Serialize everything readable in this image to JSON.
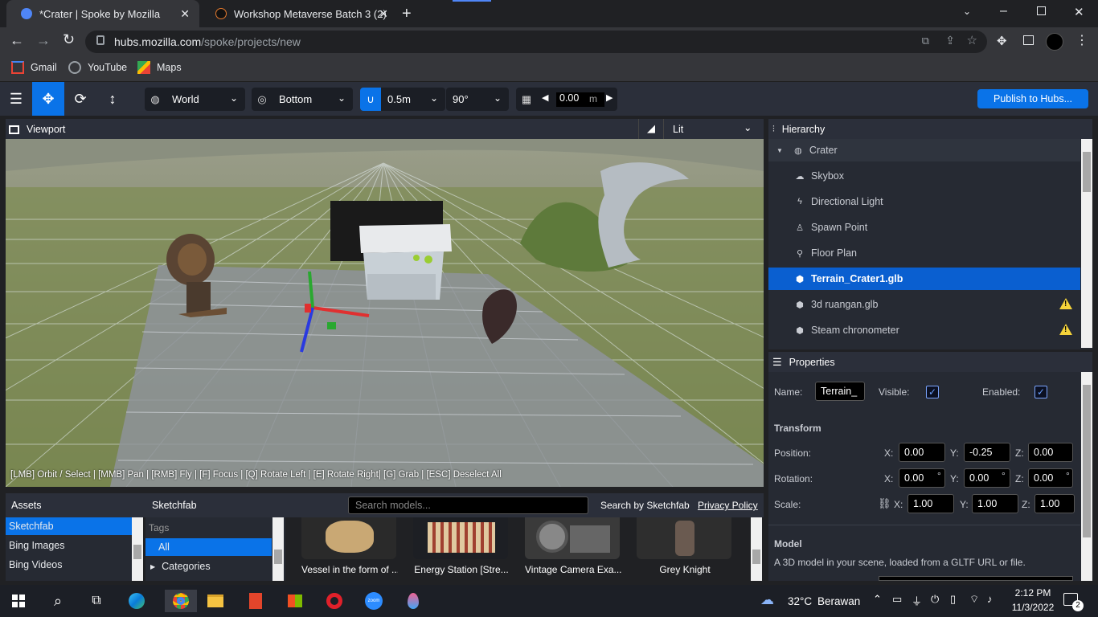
{
  "browser": {
    "tabs": [
      {
        "title": "*Crater | Spoke by Mozilla",
        "active": true
      },
      {
        "title": "Workshop Metaverse Batch 3 (2)",
        "active": false
      }
    ],
    "url_host": "hubs.mozilla.com",
    "url_path": "/spoke/projects/new",
    "bookmarks": [
      "Gmail",
      "YouTube",
      "Maps"
    ]
  },
  "toolbar": {
    "transform_space": "World",
    "pivot": "Bottom",
    "snap_translation": "0.5m",
    "snap_rotation": "90°",
    "grid_height": "0.00",
    "grid_unit": "m",
    "publish_label": "Publish to Hubs..."
  },
  "viewport": {
    "title": "Viewport",
    "render_mode": "Lit",
    "hint": "[LMB] Orbit / Select | [MMB] Pan | [RMB] Fly | [F] Focus | [Q] Rotate Left | [E] Rotate Right| [G] Grab | [ESC] Deselect All"
  },
  "hierarchy": {
    "title": "Hierarchy",
    "items": [
      {
        "label": "Crater",
        "icon": "globe-icon",
        "warning": false
      },
      {
        "label": "Skybox",
        "icon": "cloud-icon",
        "warning": false
      },
      {
        "label": "Directional Light",
        "icon": "bolt-icon",
        "warning": false
      },
      {
        "label": "Spawn Point",
        "icon": "person-icon",
        "warning": false
      },
      {
        "label": "Floor Plan",
        "icon": "walk-icon",
        "warning": false
      },
      {
        "label": "Terrain_Crater1.glb",
        "icon": "cube-icon",
        "warning": false,
        "selected": true
      },
      {
        "label": "3d ruangan.glb",
        "icon": "cube-icon",
        "warning": true
      },
      {
        "label": "Steam chronometer",
        "icon": "cube-icon",
        "warning": true
      }
    ]
  },
  "properties": {
    "title": "Properties",
    "name_label": "Name:",
    "name_value": "Terrain_",
    "visible_label": "Visible:",
    "enabled_label": "Enabled:",
    "transform_label": "Transform",
    "position_label": "Position:",
    "rotation_label": "Rotation:",
    "scale_label": "Scale:",
    "position": {
      "x": "0.00",
      "y": "-0.25",
      "z": "0.00"
    },
    "rotation": {
      "x": "0.00",
      "y": "0.00",
      "z": "0.00"
    },
    "scale": {
      "x": "1.00",
      "y": "1.00",
      "z": "1.00"
    },
    "axis_x": "X:",
    "axis_y": "Y:",
    "axis_z": "Z:",
    "degree": "°",
    "model_label": "Model",
    "model_desc": "A 3D model in your scene, loaded from a GLTF URL or file."
  },
  "assets": {
    "title": "Assets",
    "sources": [
      "Sketchfab",
      "Bing Images",
      "Bing Videos"
    ],
    "source_selected": "Sketchfab",
    "tags_label": "Tags",
    "tags": [
      "All",
      "Categories"
    ],
    "search_placeholder": "Search models...",
    "search_by": "Search by Sketchfab",
    "privacy": "Privacy Policy",
    "results": [
      "Vessel in the form of ...",
      "Energy Station [Stre...",
      "Vintage Camera Exa...",
      "Grey Knight"
    ]
  },
  "taskbar": {
    "weather_temp": "32°C",
    "weather_text": "Berawan",
    "time": "2:12 PM",
    "date": "11/3/2022",
    "notifications": "2"
  },
  "colors": {
    "accent": "#0a73e8",
    "panel": "#262a33",
    "toolbar": "#2b2f3a",
    "warning": "#f5d33a"
  }
}
